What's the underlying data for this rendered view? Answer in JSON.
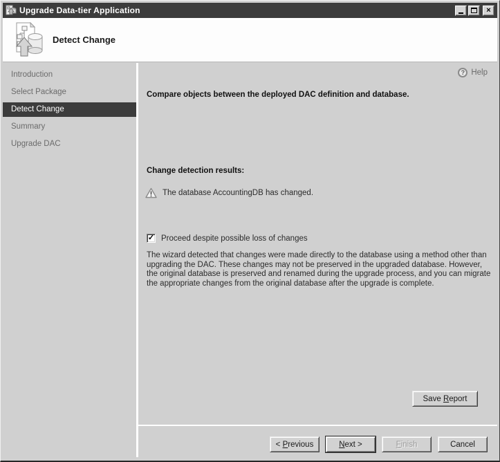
{
  "colors": {
    "titlebar_bg": "#3c3c3c",
    "selected_item_bg": "#3c3c3c",
    "background": "#d0d0d0",
    "header_bg": "#fdfdfd",
    "muted_text": "#6b6b6b"
  },
  "icons": {
    "close": "×",
    "help": "?",
    "checkmark": "✓"
  },
  "window": {
    "title": "Upgrade Data-tier Application"
  },
  "header": {
    "title": "Detect Change"
  },
  "sidebar": {
    "items": [
      {
        "label": "Introduction",
        "selected": false
      },
      {
        "label": "Select Package",
        "selected": false
      },
      {
        "label": "Detect Change",
        "selected": true
      },
      {
        "label": "Summary",
        "selected": false
      },
      {
        "label": "Upgrade DAC",
        "selected": false
      }
    ]
  },
  "main": {
    "help_label": "Help",
    "heading": "Compare objects between the deployed DAC definition and database.",
    "results_heading": "Change detection results:",
    "warning_text": "The database AccountingDB has changed.",
    "checkbox": {
      "checked": true,
      "label": "Proceed despite possible loss of changes"
    },
    "description": "The wizard detected that changes were made directly to the database using a method other than upgrading the DAC. These changes may not be preserved in the upgraded database. However, the original database is preserved and renamed during the upgrade process, and you can migrate the appropriate changes from the original database after the upgrade is complete.",
    "save_report_button": {
      "pre": "Save ",
      "key": "R",
      "post": "eport"
    }
  },
  "footer": {
    "previous_button": {
      "pre": "< ",
      "key": "P",
      "post": "revious"
    },
    "next_button": {
      "pre": "",
      "key": "N",
      "post": "ext >"
    },
    "finish_button": {
      "pre": "",
      "key": "F",
      "post": "inish"
    },
    "cancel_button": {
      "pre": "Cancel",
      "key": "",
      "post": ""
    }
  }
}
